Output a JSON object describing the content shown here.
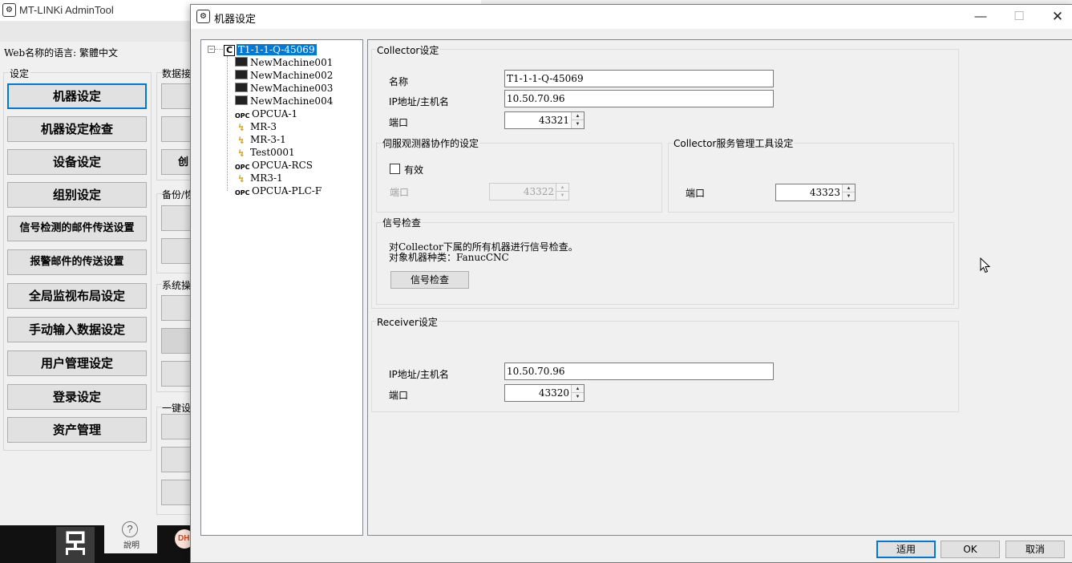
{
  "main_window": {
    "title": "MT-LINKi AdminTool",
    "web_language": "Web名称的语言: 繁體中文",
    "settings_caption": "设定",
    "buttons": [
      "机器设定",
      "机器设定检查",
      "设备设定",
      "组别设定",
      "信号检测的邮件传送设置",
      "报警邮件的传送设置",
      "全局监视布局设定",
      "手动输入数据设定",
      "用户管理设定",
      "登录设定",
      "资产管理"
    ],
    "right_captions": [
      "数据接",
      "备份/恢",
      "系统操",
      "一键设"
    ],
    "right_stub_label": "创",
    "help_label": "說明",
    "dh_logo": "DH"
  },
  "dialog": {
    "title": "机器设定",
    "window_controls": {
      "minimize": "—",
      "maximize": "☐",
      "close": "✕"
    },
    "tree": {
      "root_badge": "C",
      "root_label": "T1-1-1-Q-45069",
      "items": [
        {
          "label": "NewMachine001",
          "icon": "cnc-icon"
        },
        {
          "label": "NewMachine002",
          "icon": "cnc-icon"
        },
        {
          "label": "NewMachine003",
          "icon": "cnc-icon"
        },
        {
          "label": "NewMachine004",
          "icon": "cnc-icon"
        },
        {
          "label": "OPCUA-1",
          "icon": "opc-icon"
        },
        {
          "label": "MR-3",
          "icon": "robot-icon"
        },
        {
          "label": "MR-3-1",
          "icon": "robot-icon"
        },
        {
          "label": "Test0001",
          "icon": "robot-icon"
        },
        {
          "label": "OPCUA-RCS",
          "icon": "opc-icon"
        },
        {
          "label": "MR3-1",
          "icon": "robot-icon"
        },
        {
          "label": "OPCUA-PLC-F",
          "icon": "opc-icon"
        }
      ]
    },
    "collector": {
      "caption": "Collector设定",
      "name_label": "名称",
      "name_value": "T1-1-1-Q-45069",
      "ip_label": "IP地址/主机名",
      "ip_value": "10.50.70.96",
      "port_label": "端口",
      "port_value": "43321"
    },
    "servo": {
      "caption": "伺服观测器协作的设定",
      "enabled_label": "有效",
      "enabled": false,
      "port_label": "端口",
      "port_value": "43322"
    },
    "service_tool": {
      "caption": "Collector服务管理工具设定",
      "port_label": "端口",
      "port_value": "43323"
    },
    "signal_check": {
      "caption": "信号检查",
      "line1": "对Collector下属的所有机器进行信号检查。",
      "line2": "对象机器种类：FanucCNC",
      "button": "信号检查"
    },
    "receiver": {
      "caption": "Receiver设定",
      "ip_label": "IP地址/主机名",
      "ip_value": "10.50.70.96",
      "port_label": "端口",
      "port_value": "43320"
    },
    "footer": {
      "apply": "适用",
      "ok": "OK",
      "cancel": "取消"
    }
  }
}
